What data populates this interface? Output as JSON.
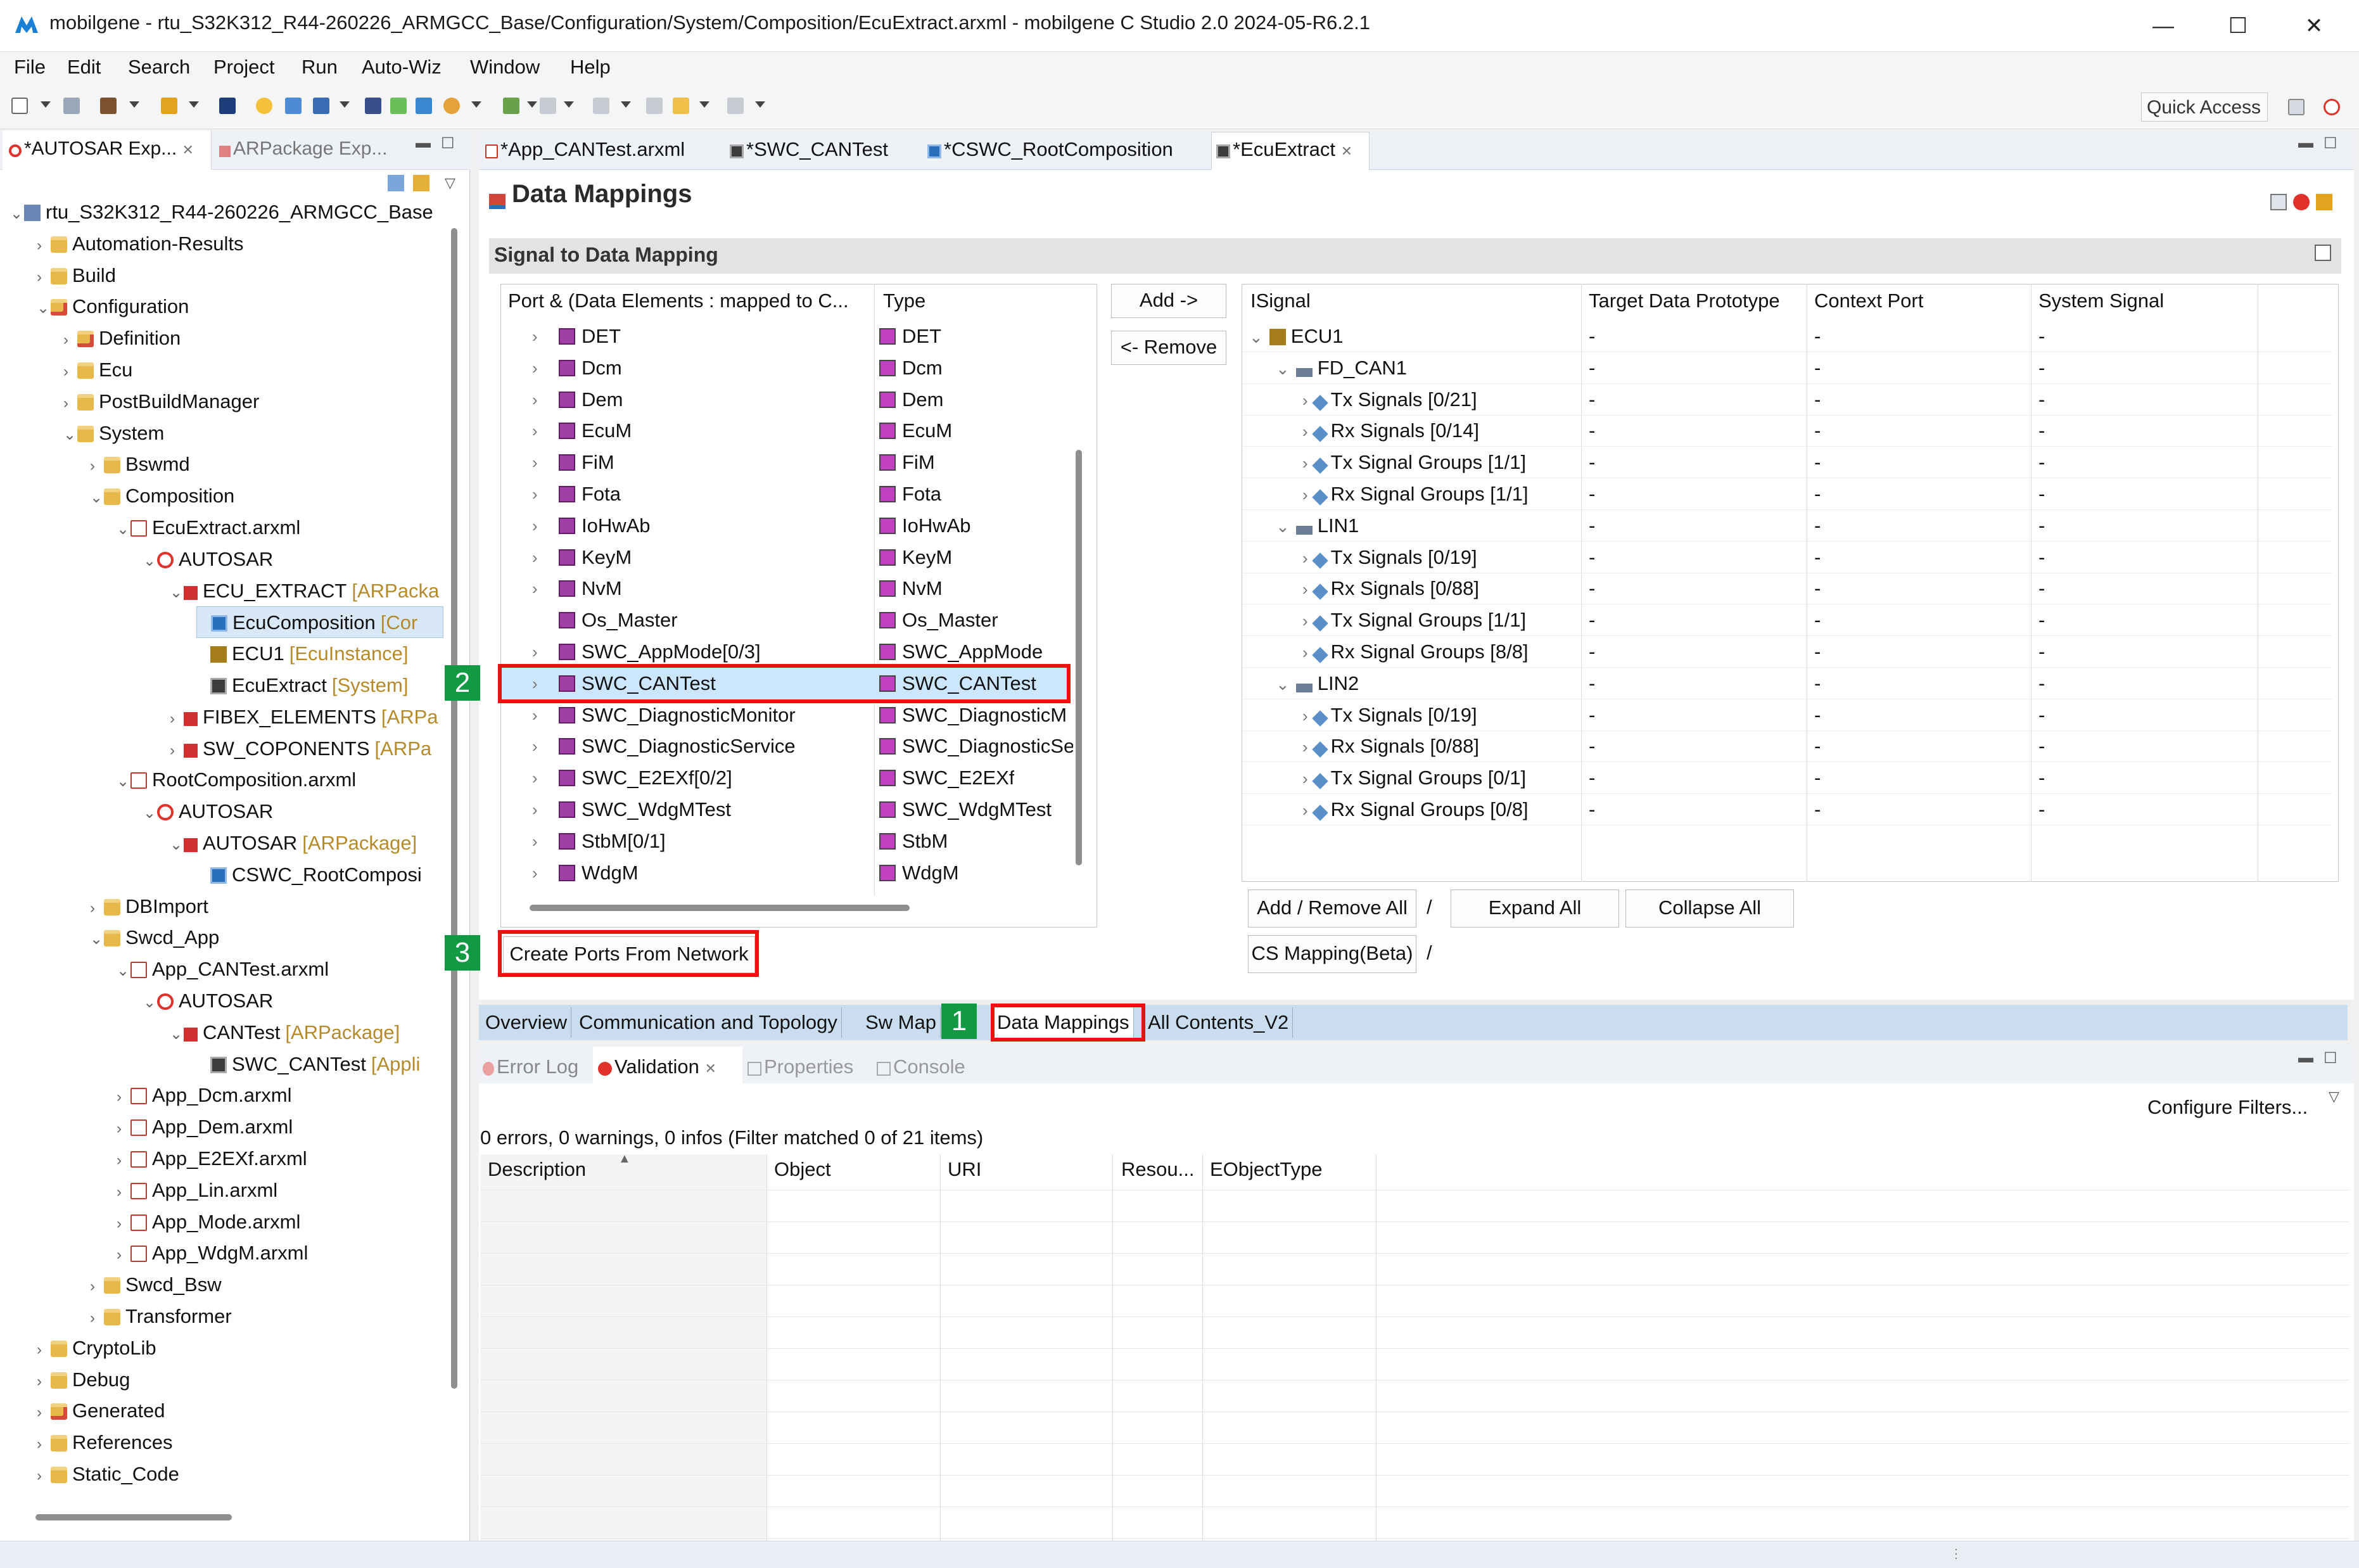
{
  "window": {
    "title": "mobilgene - rtu_S32K312_R44-260226_ARMGCC_Base/Configuration/System/Composition/EcuExtract.arxml - mobilgene C Studio 2.0 2024-05-R6.2.1",
    "minimize": "—",
    "maximize": "☐",
    "close": "✕"
  },
  "menu": [
    "File",
    "Edit",
    "Search",
    "Project",
    "Run",
    "Auto-Wiz",
    "Window",
    "Help"
  ],
  "toolbar": {
    "quick_access": "Quick Access"
  },
  "left_panel": {
    "tabs": [
      "*AUTOSAR Exp...",
      "ARPackage Exp..."
    ],
    "tree": [
      {
        "label": "rtu_S32K312_R44-260226_ARMGCC_Base",
        "suffix": ""
      },
      {
        "label": "Automation-Results",
        "suffix": ""
      },
      {
        "label": "Build",
        "suffix": ""
      },
      {
        "label": "Configuration",
        "suffix": ""
      },
      {
        "label": "Definition",
        "suffix": ""
      },
      {
        "label": "Ecu",
        "suffix": ""
      },
      {
        "label": "PostBuildManager",
        "suffix": ""
      },
      {
        "label": "System",
        "suffix": ""
      },
      {
        "label": "Bswmd",
        "suffix": ""
      },
      {
        "label": "Composition",
        "suffix": ""
      },
      {
        "label": "EcuExtract.arxml",
        "suffix": ""
      },
      {
        "label": "AUTOSAR",
        "suffix": ""
      },
      {
        "label": "ECU_EXTRACT",
        "suffix": "[ARPacka"
      },
      {
        "label": "EcuComposition",
        "suffix": "[Cor"
      },
      {
        "label": "ECU1",
        "suffix": "[EcuInstance]"
      },
      {
        "label": "EcuExtract",
        "suffix": "[System]"
      },
      {
        "label": "FIBEX_ELEMENTS",
        "suffix": "[ARPa"
      },
      {
        "label": "SW_COPONENTS",
        "suffix": "[ARPa"
      },
      {
        "label": "RootComposition.arxml",
        "suffix": ""
      },
      {
        "label": "AUTOSAR",
        "suffix": ""
      },
      {
        "label": "AUTOSAR",
        "suffix": "[ARPackage]"
      },
      {
        "label": "CSWC_RootComposi",
        "suffix": ""
      },
      {
        "label": "DBImport",
        "suffix": ""
      },
      {
        "label": "Swcd_App",
        "suffix": ""
      },
      {
        "label": "App_CANTest.arxml",
        "suffix": ""
      },
      {
        "label": "AUTOSAR",
        "suffix": ""
      },
      {
        "label": "CANTest",
        "suffix": "[ARPackage]"
      },
      {
        "label": "SWC_CANTest",
        "suffix": "[Appli"
      },
      {
        "label": "App_Dcm.arxml",
        "suffix": ""
      },
      {
        "label": "App_Dem.arxml",
        "suffix": ""
      },
      {
        "label": "App_E2EXf.arxml",
        "suffix": ""
      },
      {
        "label": "App_Lin.arxml",
        "suffix": ""
      },
      {
        "label": "App_Mode.arxml",
        "suffix": ""
      },
      {
        "label": "App_WdgM.arxml",
        "suffix": ""
      },
      {
        "label": "Swcd_Bsw",
        "suffix": ""
      },
      {
        "label": "Transformer",
        "suffix": ""
      },
      {
        "label": "CryptoLib",
        "suffix": ""
      },
      {
        "label": "Debug",
        "suffix": ""
      },
      {
        "label": "Generated",
        "suffix": ""
      },
      {
        "label": "References",
        "suffix": ""
      },
      {
        "label": "Static_Code",
        "suffix": ""
      }
    ]
  },
  "editor_tabs": [
    "*App_CANTest.arxml",
    "*SWC_CANTest",
    "*CSWC_RootComposition",
    "*EcuExtract"
  ],
  "page": {
    "title": "Data Mappings",
    "section": "Signal to Data Mapping"
  },
  "port_table": {
    "headers": [
      "Port & (Data Elements : mapped to C...",
      "Type"
    ],
    "rows": [
      {
        "port": "DET",
        "type": "DET"
      },
      {
        "port": "Dcm",
        "type": "Dcm"
      },
      {
        "port": "Dem",
        "type": "Dem"
      },
      {
        "port": "EcuM",
        "type": "EcuM"
      },
      {
        "port": "FiM",
        "type": "FiM"
      },
      {
        "port": "Fota",
        "type": "Fota"
      },
      {
        "port": "IoHwAb",
        "type": "IoHwAb"
      },
      {
        "port": "KeyM",
        "type": "KeyM"
      },
      {
        "port": "NvM",
        "type": "NvM"
      },
      {
        "port": "Os_Master",
        "type": "Os_Master"
      },
      {
        "port": "SWC_AppMode[0/3]",
        "type": "SWC_AppMode"
      },
      {
        "port": "SWC_CANTest",
        "type": "SWC_CANTest"
      },
      {
        "port": "SWC_DiagnosticMonitor",
        "type": "SWC_DiagnosticM"
      },
      {
        "port": "SWC_DiagnosticService",
        "type": "SWC_DiagnosticSe"
      },
      {
        "port": "SWC_E2EXf[0/2]",
        "type": "SWC_E2EXf"
      },
      {
        "port": "SWC_WdgMTest",
        "type": "SWC_WdgMTest"
      },
      {
        "port": "StbM[0/1]",
        "type": "StbM"
      },
      {
        "port": "WdgM",
        "type": "WdgM"
      }
    ]
  },
  "buttons": {
    "add": "Add ->",
    "remove": "<- Remove",
    "create_ports": "Create Ports From Network",
    "add_remove_all": "Add / Remove All",
    "sep1": "/",
    "expand_all": "Expand All",
    "collapse_all": "Collapse All",
    "cs_mapping": "CS Mapping(Beta)",
    "sep2": "/"
  },
  "signal_table": {
    "headers": [
      "ISignal",
      "Target Data Prototype",
      "Context Port",
      "System Signal"
    ],
    "rows": [
      {
        "label": "ECU1",
        "c1": "-",
        "c2": "-",
        "c3": "-"
      },
      {
        "label": "FD_CAN1",
        "c1": "-",
        "c2": "-",
        "c3": "-"
      },
      {
        "label": "Tx Signals [0/21]",
        "c1": "-",
        "c2": "-",
        "c3": "-"
      },
      {
        "label": "Rx Signals [0/14]",
        "c1": "-",
        "c2": "-",
        "c3": "-"
      },
      {
        "label": "Tx Signal Groups [1/1]",
        "c1": "-",
        "c2": "-",
        "c3": "-"
      },
      {
        "label": "Rx Signal Groups [1/1]",
        "c1": "-",
        "c2": "-",
        "c3": "-"
      },
      {
        "label": "LIN1",
        "c1": "-",
        "c2": "-",
        "c3": "-"
      },
      {
        "label": "Tx Signals [0/19]",
        "c1": "-",
        "c2": "-",
        "c3": "-"
      },
      {
        "label": "Rx Signals [0/88]",
        "c1": "-",
        "c2": "-",
        "c3": "-"
      },
      {
        "label": "Tx Signal Groups [1/1]",
        "c1": "-",
        "c2": "-",
        "c3": "-"
      },
      {
        "label": "Rx Signal Groups [8/8]",
        "c1": "-",
        "c2": "-",
        "c3": "-"
      },
      {
        "label": "LIN2",
        "c1": "-",
        "c2": "-",
        "c3": "-"
      },
      {
        "label": "Tx Signals [0/19]",
        "c1": "-",
        "c2": "-",
        "c3": "-"
      },
      {
        "label": "Rx Signals [0/88]",
        "c1": "-",
        "c2": "-",
        "c3": "-"
      },
      {
        "label": "Tx Signal Groups [0/1]",
        "c1": "-",
        "c2": "-",
        "c3": "-"
      },
      {
        "label": "Rx Signal Groups [0/8]",
        "c1": "-",
        "c2": "-",
        "c3": "-"
      }
    ]
  },
  "editor_bottom_tabs": [
    "Overview",
    "Communication and Topology",
    "Sw Map",
    "Data Mappings",
    "All Contents_V2"
  ],
  "badges": [
    "1",
    "2",
    "3"
  ],
  "lower_panel": {
    "tabs": [
      "Error Log",
      "Validation",
      "Properties",
      "Console"
    ],
    "status": "0 errors, 0 warnings, 0 infos (Filter matched 0 of 21 items)",
    "configure_filters": "Configure Filters...",
    "columns": [
      "Description",
      "Object",
      "URI",
      "Resou...",
      "EObjectType"
    ]
  },
  "colors": {
    "highlight": "#ee1111",
    "badge": "#119944",
    "selection": "#cce6ff",
    "tabbar": "#c9ddef"
  }
}
